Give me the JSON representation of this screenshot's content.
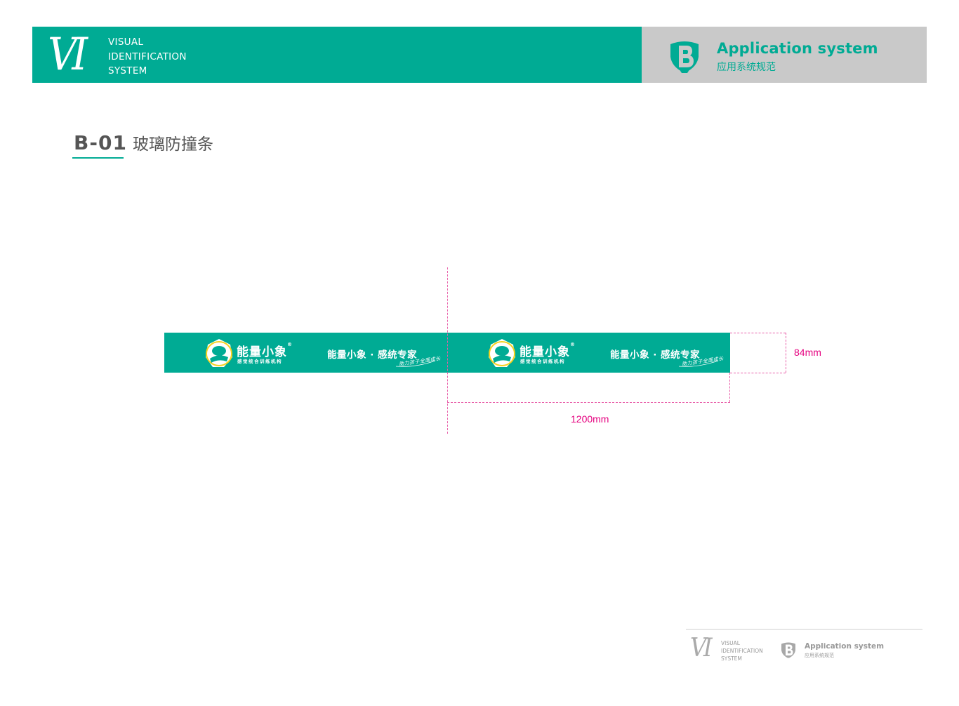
{
  "header": {
    "left": {
      "mark": "VI",
      "lines": [
        "VISUAL",
        "IDENTIFICATION",
        "SYSTEM"
      ]
    },
    "right": {
      "icon": "shield-b-icon",
      "title": "Application system",
      "subtitle": "应用系统规范"
    }
  },
  "section": {
    "code": "B-01",
    "name": "玻璃防撞条"
  },
  "strip": {
    "segments": [
      {
        "brand_name": "能量小象",
        "registered": "®",
        "brand_sub": "感觉统合训练机构",
        "logo_icon": "super-elephant-logo-icon",
        "slogan": "能量小象 · 感统专家",
        "tagline": "助力孩子全面成长"
      },
      {
        "brand_name": "能量小象",
        "registered": "®",
        "brand_sub": "感觉统合训练机构",
        "logo_icon": "super-elephant-logo-icon",
        "slogan": "能量小象 · 感统专家",
        "tagline": "助力孩子全面成长"
      }
    ],
    "color": "#00ab94"
  },
  "dimensions": {
    "height_label": "84mm",
    "width_label": "1200mm",
    "color": "#e5007f"
  },
  "footer": {
    "mark": "VI",
    "lines": [
      "VISUAL",
      "IDENTIFICATION",
      "SYSTEM"
    ],
    "title": "Application system",
    "subtitle": "应用系统规范"
  }
}
